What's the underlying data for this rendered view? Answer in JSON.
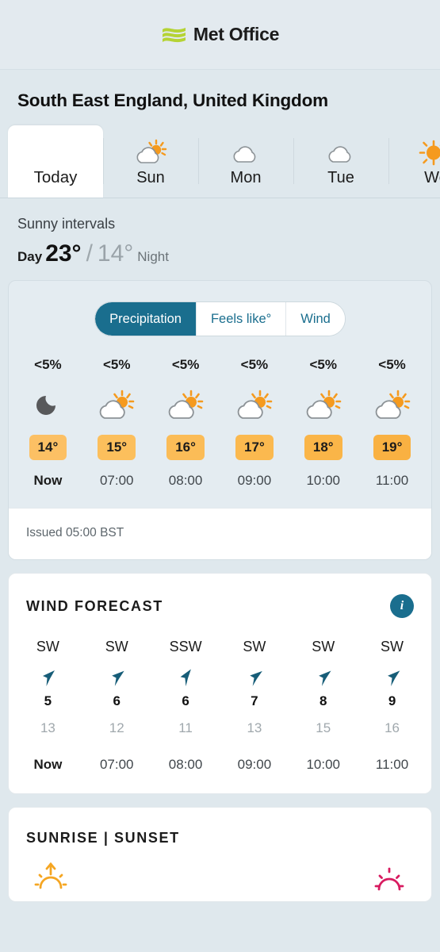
{
  "brand": {
    "name": "Met Office",
    "logo_icon": "met-office-waves-icon",
    "logo_color": "#b5d334"
  },
  "location": {
    "title": "South East England, United Kingdom"
  },
  "tabs": [
    {
      "label": "Today",
      "icon": "none",
      "active": true
    },
    {
      "label": "Sun",
      "icon": "sun-behind-cloud-icon",
      "active": false
    },
    {
      "label": "Mon",
      "icon": "cloud-icon",
      "active": false
    },
    {
      "label": "Tue",
      "icon": "cloud-icon",
      "active": false
    },
    {
      "label": "We",
      "icon": "sun-icon",
      "active": false
    }
  ],
  "summary": {
    "condition": "Sunny intervals",
    "day_label": "Day",
    "day_temp": "23°",
    "separator": "/",
    "night_temp": "14°",
    "night_label": "Night"
  },
  "segmented": {
    "options": [
      "Precipitation",
      "Feels like°",
      "Wind"
    ],
    "selected": "Precipitation"
  },
  "hourly": {
    "precip": [
      "<5%",
      "<5%",
      "<5%",
      "<5%",
      "<5%",
      "<5%"
    ],
    "icons": [
      "moon-icon",
      "sun-behind-cloud-icon",
      "sun-behind-cloud-icon",
      "sun-behind-cloud-icon",
      "sun-behind-cloud-icon",
      "sun-behind-cloud-icon"
    ],
    "temps": [
      "14°",
      "15°",
      "16°",
      "17°",
      "18°",
      "19°"
    ],
    "chip_colors": [
      "#fcc064",
      "#fcbf5c",
      "#fbbc57",
      "#fbb94f",
      "#fab548",
      "#f9b142"
    ],
    "times": [
      "Now",
      "07:00",
      "08:00",
      "09:00",
      "10:00",
      "11:00"
    ]
  },
  "issued": {
    "text": "Issued 05:00 BST"
  },
  "wind_card": {
    "title": "WIND FORECAST",
    "info_icon": "info-icon",
    "info_label": "i",
    "arrow_icon": "wind-direction-arrow-icon",
    "arrow_color": "#175d78",
    "directions": [
      "SW",
      "SW",
      "SSW",
      "SW",
      "SW",
      "SW"
    ],
    "bearings": [
      45,
      48,
      35,
      50,
      47,
      46
    ],
    "speeds": [
      "5",
      "6",
      "6",
      "7",
      "8",
      "9"
    ],
    "gusts": [
      "13",
      "12",
      "11",
      "13",
      "15",
      "16"
    ],
    "times": [
      "Now",
      "07:00",
      "08:00",
      "09:00",
      "10:00",
      "11:00"
    ]
  },
  "sun_card": {
    "title": "SUNRISE | SUNSET",
    "sunrise_icon": "sunrise-icon",
    "sunrise_color": "#f5a623",
    "sunset_icon": "sunset-icon",
    "sunset_color": "#d81b60"
  }
}
